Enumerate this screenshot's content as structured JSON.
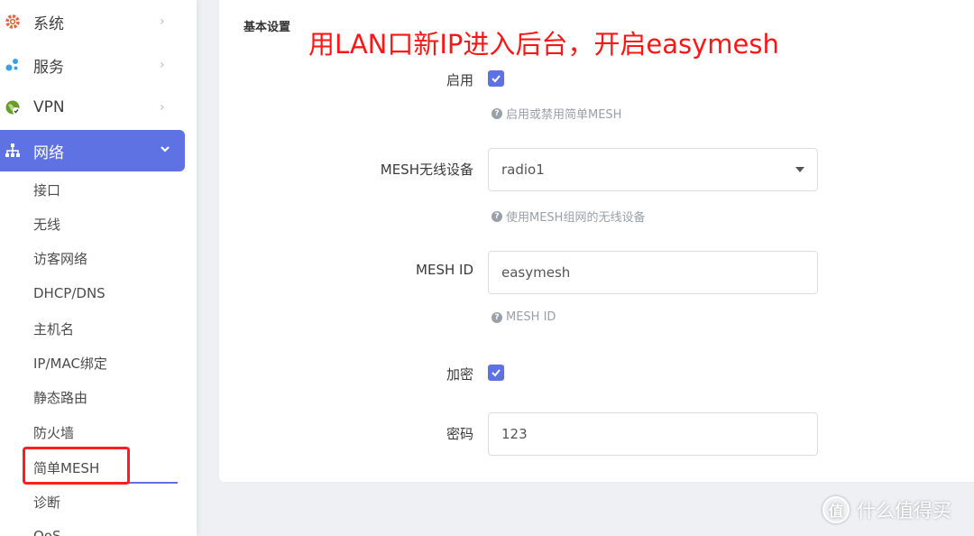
{
  "sidebar": {
    "menu": [
      {
        "label": "系统",
        "icon": "gear-icon"
      },
      {
        "label": "服务",
        "icon": "puzzle-icon"
      },
      {
        "label": "VPN",
        "icon": "globe-icon"
      },
      {
        "label": "网络",
        "icon": "sitemap-icon"
      }
    ],
    "sub_items": [
      "接口",
      "无线",
      "访客网络",
      "DHCP/DNS",
      "主机名",
      "IP/MAC绑定",
      "静态路由",
      "防火墙",
      "简单MESH",
      "诊断",
      "QoS"
    ]
  },
  "main": {
    "section_title": "基本设置",
    "annotation": "用LAN口新IP进入后台，开启easymesh",
    "enable": {
      "label": "启用",
      "hint": "启用或禁用简单MESH"
    },
    "mesh_device": {
      "label": "MESH无线设备",
      "value": "radio1",
      "hint": "使用MESH组网的无线设备"
    },
    "mesh_id": {
      "label": "MESH ID",
      "value": "easymesh",
      "hint": "MESH ID"
    },
    "encrypt": {
      "label": "加密"
    },
    "password": {
      "label": "密码",
      "value": "123"
    }
  },
  "watermark": {
    "badge": "值",
    "text": "什么值得买"
  },
  "colors": {
    "accent": "#5e72e4",
    "annotation": "#ff1515",
    "gear": "#e8643a",
    "puzzle": "#3aa0e8",
    "globe": "#7cb342"
  }
}
